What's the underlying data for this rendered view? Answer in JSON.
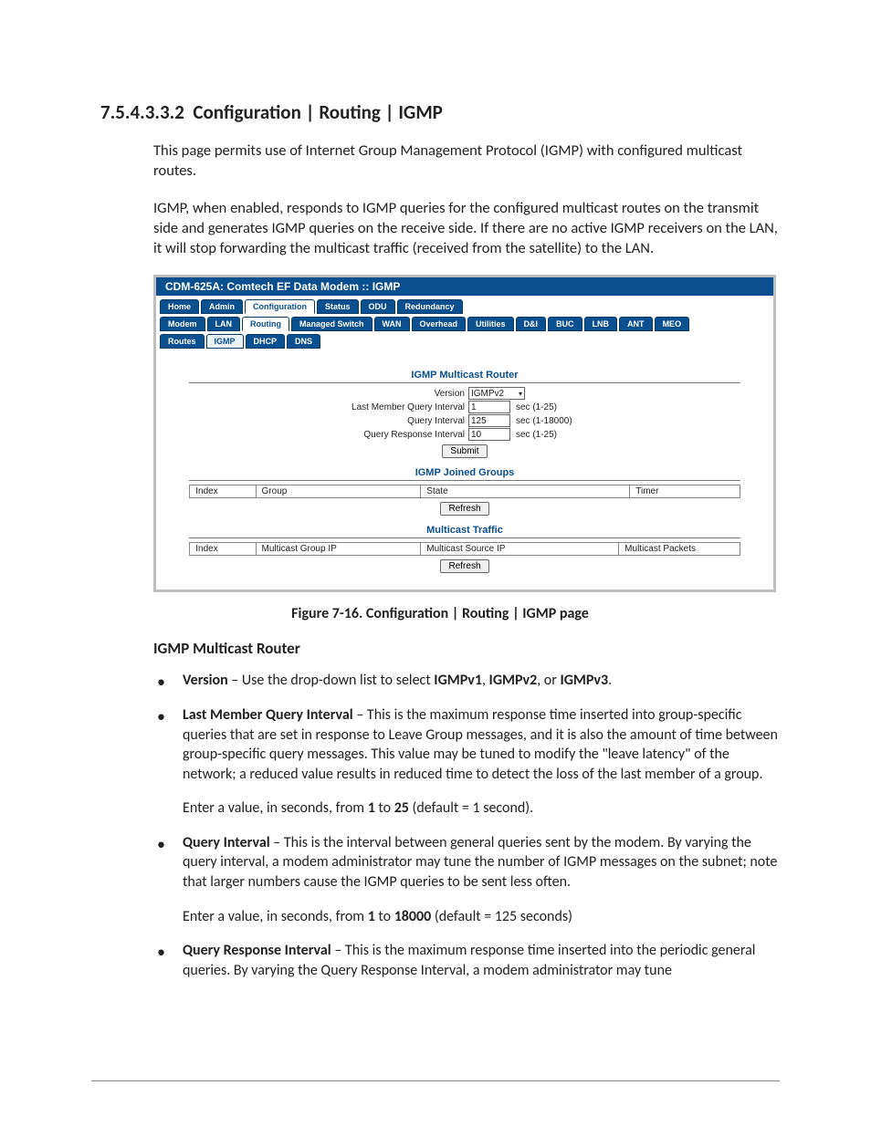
{
  "heading_number": "7.5.4.3.3.2",
  "heading_title": "Configuration | Routing | IGMP",
  "para1": "This page permits use of Internet Group Management Protocol (IGMP) with configured multicast routes.",
  "para2": "IGMP, when enabled, responds to IGMP queries for the configured multicast routes on the transmit side and generates IGMP queries on the receive side. If there are no active IGMP receivers on the LAN, it will stop forwarding the multicast traffic (received from the satellite) to the LAN.",
  "figure_caption": "Figure 7-16. Configuration | Routing | IGMP page",
  "sub_heading": "IGMP Multicast Router",
  "bullets": {
    "b1_label": "Version",
    "b1_text": " – Use the drop-down list to select ",
    "b1_opt1": "IGMPv1",
    "b1_sep1": ", ",
    "b1_opt2": "IGMPv2",
    "b1_sep2": ", or ",
    "b1_opt3": "IGMPv3",
    "b1_end": ".",
    "b2_label": "Last Member Query Interval",
    "b2_text": " – This is the maximum response time inserted into group-specific queries that are set in response to Leave Group messages, and it is also the amount of time between group-specific query messages. This value may be tuned to modify the \"leave latency\" of the network; a reduced value results in reduced time to detect the loss of the last member of a group.",
    "b2_sub_pre": "Enter a value, in seconds, from ",
    "b2_sub_n1": "1",
    "b2_sub_to": " to ",
    "b2_sub_n2": "25",
    "b2_sub_post": " (default = 1 second).",
    "b3_label": "Query Interval",
    "b3_text": " – This is the interval between general queries sent by the modem. By varying the query interval, a modem administrator may tune the number of IGMP messages on the subnet; note that larger numbers cause the IGMP queries to be sent less often.",
    "b3_sub_pre": "Enter a value, in seconds, from ",
    "b3_sub_n1": "1",
    "b3_sub_to": " to ",
    "b3_sub_n2": "18000",
    "b3_sub_post": " (default = 125 seconds)",
    "b4_label": "Query Response Interval",
    "b4_text": " – This is the maximum response time inserted into the periodic general queries. By varying the Query Response Interval, a modem administrator may tune"
  },
  "fig": {
    "titlebar": "CDM-625A: Comtech EF Data Modem :: IGMP",
    "tabs_row1": [
      "Home",
      "Admin",
      "Configuration",
      "Status",
      "ODU",
      "Redundancy"
    ],
    "tabs_row2": [
      "Modem",
      "LAN",
      "Routing",
      "Managed Switch",
      "WAN",
      "Overhead",
      "Utilities",
      "D&I",
      "BUC",
      "LNB",
      "ANT",
      "MEO"
    ],
    "tabs_row3": [
      "Routes",
      "IGMP",
      "DHCP",
      "DNS"
    ],
    "panel1": {
      "title": "IGMP Multicast Router",
      "row1_label": "Version",
      "row1_value": "IGMPv2",
      "row2_label": "Last Member Query Interval",
      "row2_value": "1",
      "row2_hint": "sec (1-25)",
      "row3_label": "Query Interval",
      "row3_value": "125",
      "row3_hint": "sec (1-18000)",
      "row4_label": "Query Response Interval",
      "row4_value": "10",
      "row4_hint": "sec (1-25)",
      "submit": "Submit"
    },
    "panel2": {
      "title": "IGMP Joined Groups",
      "cols": [
        "Index",
        "Group",
        "State",
        "Timer"
      ],
      "refresh": "Refresh"
    },
    "panel3": {
      "title": "Multicast Traffic",
      "cols": [
        "Index",
        "Multicast Group IP",
        "Multicast Source IP",
        "Multicast Packets"
      ],
      "refresh": "Refresh"
    }
  }
}
